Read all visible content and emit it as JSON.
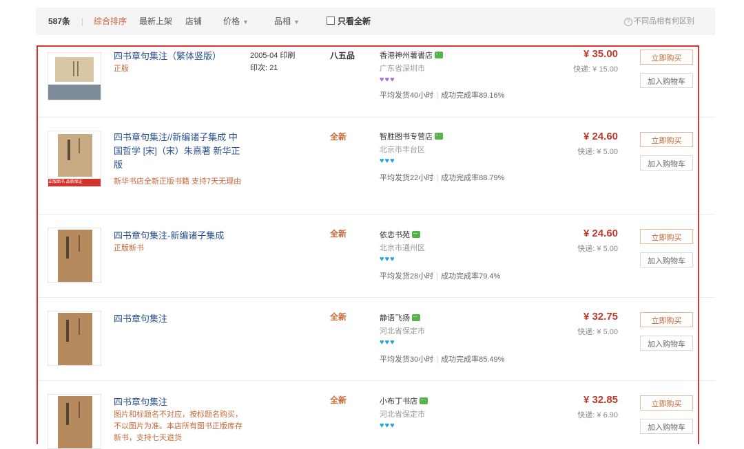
{
  "filter_bar": {
    "count": "587条",
    "separator": "|",
    "sorts": [
      {
        "label": "综合排序",
        "active": true
      },
      {
        "label": "最新上架"
      },
      {
        "label": "店铺"
      },
      {
        "label": "价格"
      },
      {
        "label": "品相"
      }
    ],
    "only_new_label": "只看全新",
    "help_icon": "question-circle-icon",
    "help_label": "不同品相有何区别"
  },
  "buttons": {
    "buy": "立即购买",
    "cart": "加入购物车"
  },
  "colors": {
    "accent": "#c8693a",
    "price": "#c0392b",
    "title": "#2a4f8f",
    "selection": "#e0312b",
    "chat": "#54b44b"
  },
  "listings": [
    {
      "title": "四书章句集注（繁体竖版）",
      "subtitle": "正版",
      "pub_date": "2005-04 印刷",
      "print": "印次: 21",
      "condition": "八五品",
      "shop": "香港神州薯書店",
      "location": "广东省深圳市",
      "hearts": "♥♥♥",
      "heart_color": "purple",
      "avg_ship": "平均发货40小时",
      "rate": "成功完成率89.16%",
      "price": "¥ 35.00",
      "shipping": "快递: ¥ 15.00"
    },
    {
      "title": "四书章句集注//新编诸子集成 中国哲学 [宋]（宋）朱熹著 新华正版",
      "subtitle": "新华书店全新正版书籍 支持7天无理由",
      "badge": "正版图书 品质保证",
      "condition": "全新",
      "shop": "智胜图书专营店",
      "location": "北京市丰台区",
      "hearts": "♥♥♥",
      "heart_color": "blue",
      "avg_ship": "平均发货22小时",
      "rate": "成功完成率88.79%",
      "price": "¥ 24.60",
      "shipping": "快递: ¥ 5.00"
    },
    {
      "title": "四书章句集注-新编诸子集成",
      "subtitle": "正版新书",
      "condition": "全新",
      "shop": "依恋书苑",
      "location": "北京市通州区",
      "hearts": "♥♥♥",
      "heart_color": "blue",
      "avg_ship": "平均发货28小时",
      "rate": "成功完成率79.4%",
      "price": "¥ 24.60",
      "shipping": "快递: ¥ 5.00"
    },
    {
      "title": "四书章句集注",
      "subtitle": "",
      "condition": "全新",
      "shop": "静语飞扬",
      "location": "河北省保定市",
      "hearts": "♥♥♥",
      "heart_color": "blue",
      "avg_ship": "平均发货30小时",
      "rate": "成功完成率85.49%",
      "price": "¥ 32.75",
      "shipping": "快递: ¥ 5.00"
    },
    {
      "title": "四书章句集注",
      "subtitle": "图片和标题名不对应，按标题名购买，不以图片为准。本店所有图书正版库存新书，支持七天退货",
      "condition": "全新",
      "shop": "小布丁书店",
      "location": "河北省保定市",
      "hearts": "♥♥♥",
      "heart_color": "blue",
      "avg_ship": "",
      "rate": "",
      "price": "¥ 32.85",
      "shipping": "快递: ¥ 6.90"
    }
  ]
}
